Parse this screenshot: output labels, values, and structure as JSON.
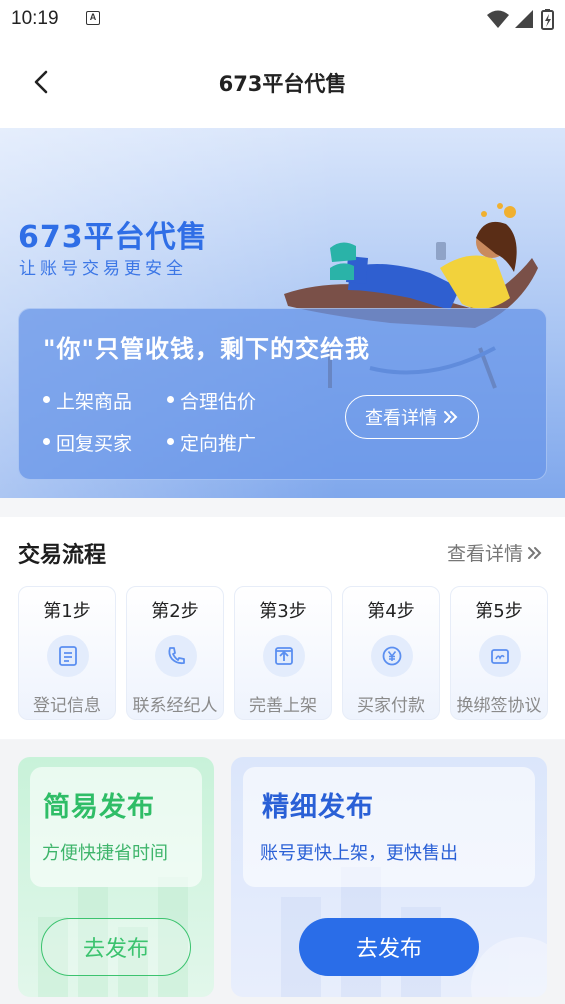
{
  "status_bar": {
    "time": "10:19",
    "indicator": "A"
  },
  "nav": {
    "title": "673平台代售"
  },
  "banner": {
    "title": "673平台代售",
    "subtitle": "让账号交易更安全",
    "headline": "\"你\"只管收钱，剩下的交给我",
    "features": [
      "上架商品",
      "合理估价",
      "回复买家",
      "定向推广"
    ],
    "detail_button": "查看详情"
  },
  "process": {
    "title": "交易流程",
    "more": "查看详情",
    "steps": [
      {
        "num": "第1步",
        "label": "登记信息",
        "icon": "form-icon"
      },
      {
        "num": "第2步",
        "label": "联系经纪人",
        "icon": "phone-icon"
      },
      {
        "num": "第3步",
        "label": "完善上架",
        "icon": "upload-icon"
      },
      {
        "num": "第4步",
        "label": "买家付款",
        "icon": "yen-icon"
      },
      {
        "num": "第5步",
        "label": "换绑签协议",
        "icon": "contract-icon"
      }
    ]
  },
  "publish": {
    "simple": {
      "title": "简易发布",
      "subtitle": "方便快捷省时间",
      "button": "去发布"
    },
    "fine": {
      "title": "精细发布",
      "subtitle": "账号更快上架，更快售出",
      "button": "去发布"
    }
  },
  "colors": {
    "accent": "#2a6de8",
    "green": "#3cc36f",
    "banner_title": "#2f6ee6"
  }
}
